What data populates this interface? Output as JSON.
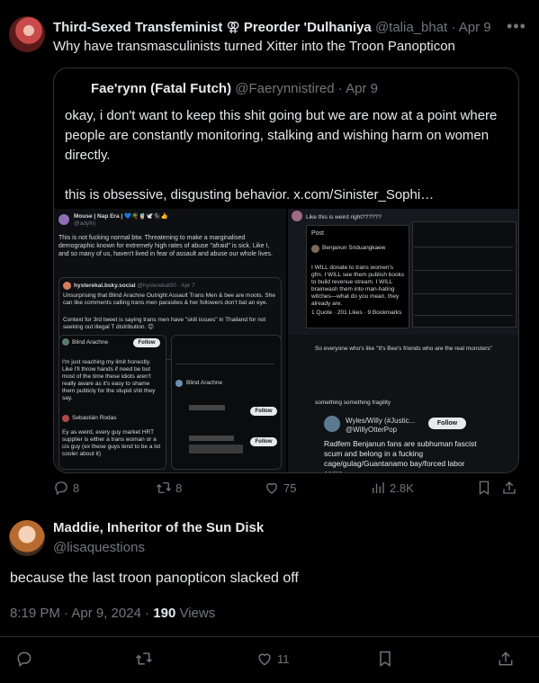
{
  "post": {
    "display_name": "Third-Sexed Transfeminist",
    "name_emoji": "⚢",
    "name_suffix": "Preorder 'Dulhaniya",
    "handle": "@talia_bhat",
    "date": "Apr 9",
    "text": "Why have transmasculinists turned Xitter into the Troon Panopticon",
    "quote": {
      "display_name": "Fae'rynn (Fatal Futch)",
      "handle": "@Faerynnistired",
      "date": "Apr 9",
      "paragraph1": "okay, i don't want to keep this shit going but we are now at a point where people are constantly monitoring, stalking and wishing harm on women directly.",
      "paragraph2": "this is obsessive, disgusting behavior.  x.com/Sinister_Sophi…",
      "media_left": {
        "author": "Mouse | Nap Era | 💙🌴🧋🕊️🐈‍⬛👍",
        "handle": "@adyfnj",
        "body": "This is not fucking normal btw. Threatening to make a marginalised demographic known for extremely high rates of abuse \"afraid\" is sick. Like I, and so many of us, haven't lived in fear of assault and abuse our whole lives.",
        "inner_author": "hysterekal.bsky.social",
        "inner_meta": "@hysterekal00 · Apr 7",
        "inner_body": "Unsurprising that Blind Arachne Outright Assault Trans Men & bee are moots. She can like comments calling trans men parasites & her followers don't bat an eye.",
        "inner_body2": "Context for 3rd tweet is saying trans men have \"skill issues\" in Thailand for not seeking out illegal T distribution. 😊",
        "sub1_name": "Blind Arachne",
        "sub1_text": "I'm just reaching my limit honestly. Like I'll throw hands if need be but most of the time these idiots aren't really aware as it's easy to shame them publicly for the stupid shit they say.",
        "sub2_name": "Sebastián Rodas",
        "sub2_text": "Ey as weird, every guy market HRT supplier is either a trans woman or a cis guy (ex these guys tend to be a lot cooler about it)",
        "follow": "Follow"
      },
      "media_right": {
        "top": "Like this is weird right??????",
        "post_label": "Post",
        "post_author": "Benjanun Sriduangkaew",
        "post_body": "I WILL donate to trans women's gfm. I WILL see them publish books to build revenue stream. I WILL brainwash them into man-hating witches—what do you mean, they already are.",
        "post_stats": "1 Quote · 201 Likes · 9 Bookmarks",
        "bottom_quote": "So everyone who's like \"It's Bee's friends who are the real monsters\"",
        "bottom_sub": "something something fragility",
        "wyles": "Wyles/Willy (#Justic...",
        "wyles_handle": "@WillyOtterPop",
        "follow": "Follow",
        "bottom_text": "Radfem Benjanun fans are subhuman fascist scum and belong in a fucking cage/gulag/Guantanamo bay/forced labor camp"
      }
    },
    "actions": {
      "replies": "8",
      "reposts": "8",
      "likes": "75",
      "views": "2.8K"
    }
  },
  "reply": {
    "display_name": "Maddie, Inheritor of the Sun Disk",
    "handle": "@lisaquestions",
    "text": "because the last troon panopticon slacked off",
    "time": "8:19 PM · Apr 9, 2024 · ",
    "views_count": "190",
    "views_label": " Views",
    "likes": "11"
  },
  "icons": [
    "reply-icon",
    "repost-icon",
    "like-icon",
    "views-icon",
    "bookmark-icon",
    "share-icon",
    "more-icon"
  ],
  "colors": {
    "background": "#000000",
    "text": "#e7e9ea",
    "muted": "#71767b",
    "border": "#2f3336"
  }
}
